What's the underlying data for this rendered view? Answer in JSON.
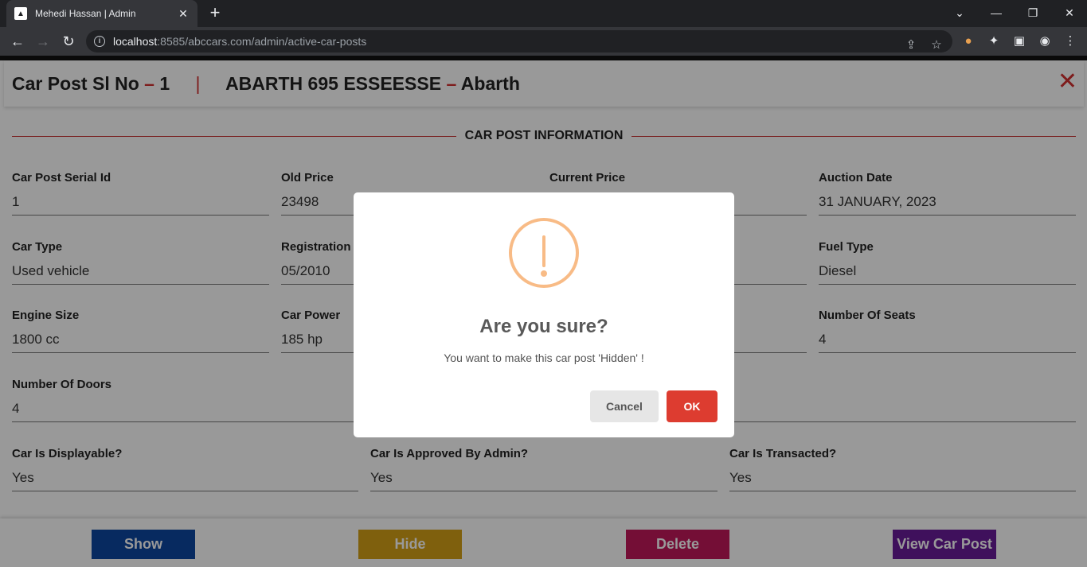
{
  "browser": {
    "tab_title": "Mehedi Hassan | Admin",
    "url_host": "localhost",
    "url_rest": ":8585/abccars.com/admin/active-car-posts"
  },
  "header": {
    "label": "Car Post Sl No",
    "dash1": "–",
    "serial": "1",
    "sep": "|",
    "model": "ABARTH 695 ESSEESSE",
    "dash2": "–",
    "make": "Abarth"
  },
  "section_title": "CAR POST INFORMATION",
  "fields": {
    "serial_id": {
      "label": "Car Post Serial Id",
      "value": "1"
    },
    "old_price": {
      "label": "Old Price",
      "value": "23498"
    },
    "current_price": {
      "label": "Current Price",
      "value": ""
    },
    "auction_date": {
      "label": "Auction Date",
      "value": "31 JANUARY, 2023"
    },
    "car_type": {
      "label": "Car Type",
      "value": "Used vehicle"
    },
    "registration": {
      "label": "Registration D",
      "value": "05/2010"
    },
    "fuel_type": {
      "label": "Fuel Type",
      "value": "Diesel"
    },
    "engine_size": {
      "label": "Engine Size",
      "value": "1800 cc"
    },
    "car_power": {
      "label": "Car Power",
      "value": "185 hp"
    },
    "seats": {
      "label": "Number Of Seats",
      "value": "4"
    },
    "doors": {
      "label": "Number Of Doors",
      "value": "4"
    },
    "displayable": {
      "label": "Car Is Displayable?",
      "value": "Yes"
    },
    "approved": {
      "label": "Car Is Approved By Admin?",
      "value": "Yes"
    },
    "transacted": {
      "label": "Car Is Transacted?",
      "value": "Yes"
    }
  },
  "actions": {
    "show": "Show",
    "hide": "Hide",
    "delete": "Delete",
    "view": "View Car Post"
  },
  "colors": {
    "show": "#0d47a1",
    "hide": "#d4a017",
    "delete": "#c2185b",
    "view": "#6a1b9a",
    "accent_red": "#d32f2f"
  },
  "modal": {
    "title": "Are you sure?",
    "text": "You want to make this car post 'Hidden' !",
    "cancel": "Cancel",
    "ok": "OK",
    "icon": "warning-icon"
  }
}
